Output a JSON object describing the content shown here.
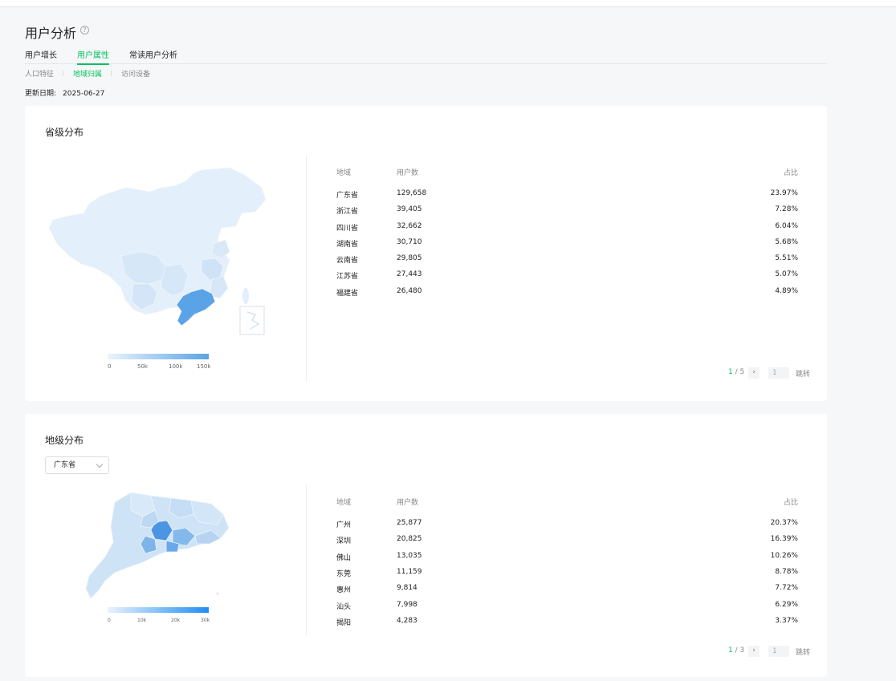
{
  "page": {
    "title": "用户分析",
    "tabs": [
      "用户增长",
      "用户属性",
      "常读用户分析"
    ],
    "subtabs": [
      "人口特征",
      "地域归属",
      "访问设备"
    ],
    "update_label": "更新日期:",
    "update_date": "2025-06-27",
    "accent": "#07c160"
  },
  "province": {
    "title": "省级分布",
    "columns": [
      "地域",
      "用户数",
      "占比"
    ],
    "rows": [
      {
        "region": "广东省",
        "users": "129,658",
        "pct": "23.97%"
      },
      {
        "region": "浙江省",
        "users": "39,405",
        "pct": "7.28%"
      },
      {
        "region": "四川省",
        "users": "32,662",
        "pct": "6.04%"
      },
      {
        "region": "湖南省",
        "users": "30,710",
        "pct": "5.68%"
      },
      {
        "region": "云南省",
        "users": "29,805",
        "pct": "5.51%"
      },
      {
        "region": "江苏省",
        "users": "27,443",
        "pct": "5.07%"
      },
      {
        "region": "福建省",
        "users": "26,480",
        "pct": "4.89%"
      }
    ],
    "legend": [
      "0",
      "50k",
      "100k",
      "150k"
    ],
    "pager": {
      "current": "1",
      "total": "5",
      "input": "1",
      "jump": "跳转"
    }
  },
  "city": {
    "title": "地级分布",
    "select_value": "广东省",
    "columns": [
      "地域",
      "用户数",
      "占比"
    ],
    "rows": [
      {
        "region": "广州",
        "users": "25,877",
        "pct": "20.37%"
      },
      {
        "region": "深圳",
        "users": "20,825",
        "pct": "16.39%"
      },
      {
        "region": "佛山",
        "users": "13,035",
        "pct": "10.26%"
      },
      {
        "region": "东莞",
        "users": "11,159",
        "pct": "8.78%"
      },
      {
        "region": "惠州",
        "users": "9,814",
        "pct": "7.72%"
      },
      {
        "region": "汕头",
        "users": "7,998",
        "pct": "6.29%"
      },
      {
        "region": "揭阳",
        "users": "4,283",
        "pct": "3.37%"
      }
    ],
    "legend": [
      "0",
      "10k",
      "20k",
      "30k"
    ],
    "pager": {
      "current": "1",
      "total": "3",
      "input": "1",
      "jump": "跳转"
    }
  }
}
